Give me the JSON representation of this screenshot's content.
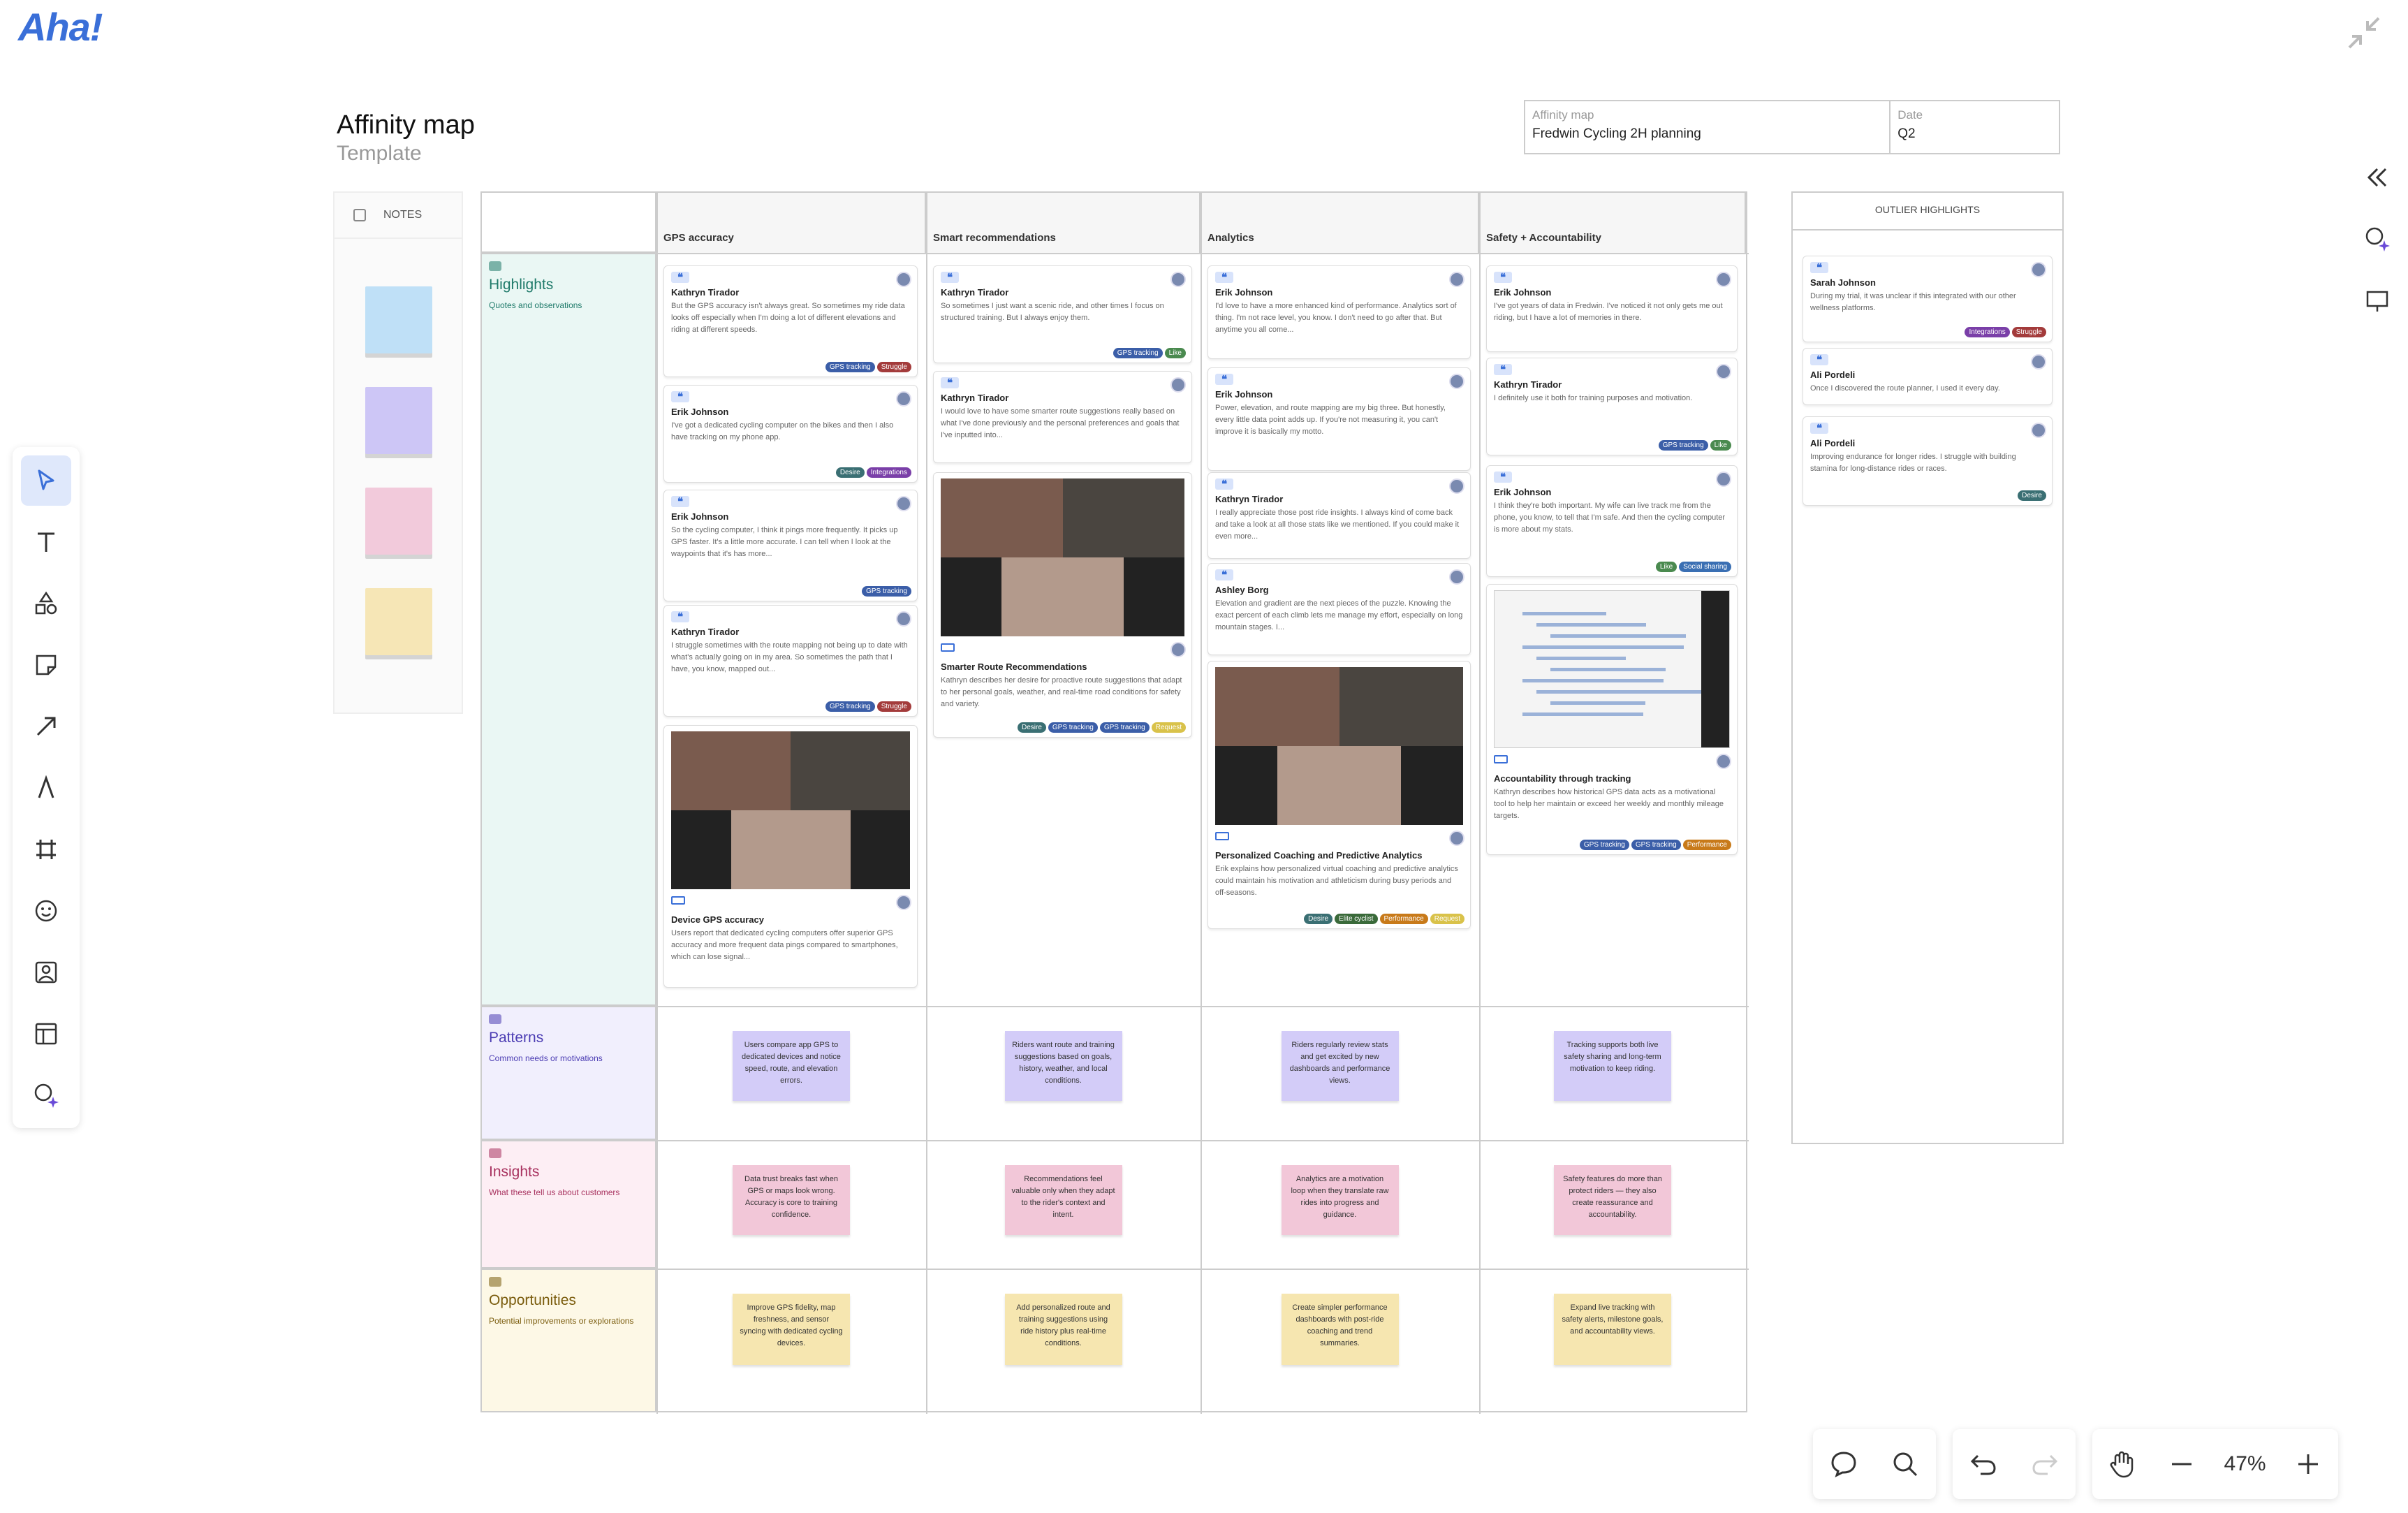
{
  "app": {
    "logo": "Aha!"
  },
  "board": {
    "title": "Affinity map",
    "subtitle": "Template",
    "meta": [
      {
        "label": "Affinity map",
        "value": "Fredwin Cycling 2H planning"
      },
      {
        "label": "Date",
        "value": "Q2"
      }
    ]
  },
  "notes_panel": {
    "label": "NOTES",
    "colors": [
      "#bfe0f7",
      "#cdc6f6",
      "#f2cadb",
      "#f6e6b6"
    ]
  },
  "columns": [
    "GPS accuracy",
    "Smart recommendations",
    "Analytics",
    "Safety + Accountability"
  ],
  "rows": [
    {
      "title": "Highlights",
      "desc": "Quotes and observations",
      "color": "#eaf7f4",
      "text": "#1f7a6a"
    },
    {
      "title": "Patterns",
      "desc": "Common needs or motivations",
      "color": "#f1effd",
      "text": "#4b3cb3"
    },
    {
      "title": "Insights",
      "desc": "What these tell us about customers",
      "color": "#fdeef4",
      "text": "#a8325f"
    },
    {
      "title": "Opportunities",
      "desc": "Potential improvements or explorations",
      "color": "#fdf8e6",
      "text": "#7a5c0d"
    }
  ],
  "tag_colors": {
    "GPS tracking": "#3b5ea8",
    "Struggle": "#a33b3b",
    "Desire": "#3a6f73",
    "Integrations": "#7a3fa8",
    "Like": "#4a8a4f",
    "Social sharing": "#3a6fb3",
    "Performance": "#c87a1a",
    "Request": "#d9c24a",
    "Elite cyclist": "#3a6a3a"
  },
  "highlights": [
    [
      {
        "name": "Kathryn Tirador",
        "text": "But the GPS accuracy isn't always great. So sometimes my ride data looks off especially when I'm doing a lot of different elevations and riding at different speeds.",
        "tags": [
          "GPS tracking",
          "Struggle"
        ]
      },
      {
        "name": "Erik Johnson",
        "text": "I've got a dedicated cycling computer on the bikes and then I also have tracking on my phone app.",
        "tags": [
          "Desire",
          "Integrations"
        ]
      },
      {
        "name": "Erik Johnson",
        "text": "So the cycling computer, I think it pings more frequently. It picks up GPS faster. It's a little more accurate. I can tell when I look at the waypoints that it's has more...",
        "tags": [
          "GPS tracking"
        ]
      },
      {
        "name": "Kathryn Tirador",
        "text": "I struggle sometimes with the route mapping not being up to date with what's actually going on in my area. So sometimes the path that I have, you know, mapped out...",
        "tags": [
          "GPS tracking",
          "Struggle"
        ]
      },
      {
        "video": true,
        "name": "Device GPS accuracy",
        "text": "Users report that dedicated cycling computers offer superior GPS accuracy and more frequent data pings compared to smartphones, which can lose signal...",
        "tags": []
      }
    ],
    [
      {
        "name": "Kathryn Tirador",
        "text": "So sometimes I just want a scenic ride, and other times I focus on structured training. But I always enjoy them.",
        "tags": [
          "GPS tracking",
          "Like"
        ]
      },
      {
        "name": "Kathryn Tirador",
        "text": "I would love to have some smarter route suggestions really based on what I've done previously and the personal preferences and goals that I've inputted into...",
        "tags": []
      },
      {
        "video": true,
        "name": "Smarter Route Recommendations",
        "text": "Kathryn describes her desire for proactive route suggestions that adapt to her personal goals, weather, and real-time road conditions for safety and variety.",
        "tags": [
          "Desire",
          "GPS tracking",
          "GPS tracking",
          "Request"
        ]
      }
    ],
    [
      {
        "name": "Erik Johnson",
        "text": "I'd love to have a more enhanced kind of performance. Analytics sort of thing. I'm not race level, you know. I don't need to go after that. But anytime you all come...",
        "tags": []
      },
      {
        "name": "Erik Johnson",
        "text": "Power, elevation, and route mapping are my big three. But honestly, every little data point adds up. If you're not measuring it, you can't improve it is basically my motto.",
        "tags": []
      },
      {
        "name": "Kathryn Tirador",
        "text": "I really appreciate those post ride insights. I always kind of come back and take a look at all those stats like we mentioned. If you could make it even more...",
        "tags": []
      },
      {
        "name": "Ashley Borg",
        "text": "Elevation and gradient are the next pieces of the puzzle. Knowing the exact percent of each climb lets me manage my effort, especially on long mountain stages. I...",
        "tags": []
      },
      {
        "video": true,
        "name": "Personalized Coaching and Predictive Analytics",
        "text": "Erik explains how personalized virtual coaching and predictive analytics could maintain his motivation and athleticism during busy periods and off-seasons.",
        "tags": [
          "Desire",
          "Elite cyclist",
          "Performance",
          "Request"
        ]
      }
    ],
    [
      {
        "name": "Erik Johnson",
        "text": "I've got years of data in Fredwin. I've noticed it not only gets me out riding, but I have a lot of memories in there.",
        "tags": []
      },
      {
        "name": "Kathryn Tirador",
        "text": "I definitely use it both for training purposes and motivation.",
        "tags": [
          "GPS tracking",
          "Like"
        ]
      },
      {
        "name": "Erik Johnson",
        "text": "I think they're both important. My wife can live track me from the phone, you know, to tell that I'm safe. And then the cycling computer is more about my stats.",
        "tags": [
          "Like",
          "Social sharing"
        ]
      },
      {
        "video": true,
        "screen": true,
        "name": "Accountability through tracking",
        "text": "Kathryn describes how historical GPS data acts as a motivational tool to help her maintain or exceed her weekly and monthly mileage targets.",
        "tags": [
          "GPS tracking",
          "GPS tracking",
          "Performance"
        ]
      }
    ]
  ],
  "patterns": [
    "Users compare app GPS to dedicated devices and notice speed, route, and elevation errors.",
    "Riders want route and training suggestions based on goals, history, weather, and local conditions.",
    "Riders regularly review stats and get excited by new dashboards and performance views.",
    "Tracking supports both live safety sharing and long-term motivation to keep riding."
  ],
  "insights": [
    "Data trust breaks fast when GPS or maps look wrong. Accuracy is core to training confidence.",
    "Recommendations feel valuable only when they adapt to the rider's context and intent.",
    "Analytics are a motivation loop when they translate raw rides into progress and guidance.",
    "Safety features do more than protect riders — they also create reassurance and accountability."
  ],
  "opportunities": [
    "Improve GPS fidelity, map freshness, and sensor syncing with dedicated cycling devices.",
    "Add personalized route and training suggestions using ride history plus real-time conditions.",
    "Create simpler performance dashboards with post-ride coaching and trend summaries.",
    "Expand live tracking with safety alerts, milestone goals, and accountability views."
  ],
  "outlier": {
    "title": "OUTLIER HIGHLIGHTS",
    "cards": [
      {
        "name": "Sarah Johnson",
        "text": "During my trial, it was unclear if this integrated with our other wellness platforms.",
        "tags": [
          "Integrations",
          "Struggle"
        ]
      },
      {
        "name": "Ali Pordeli",
        "text": "Once I discovered the route planner, I used it every day.",
        "tags": []
      },
      {
        "name": "Ali Pordeli",
        "text": "Improving endurance for longer rides. I struggle with building stamina for long-distance rides or races.",
        "tags": [
          "Desire"
        ]
      }
    ]
  },
  "zoom": {
    "value": "47%"
  }
}
